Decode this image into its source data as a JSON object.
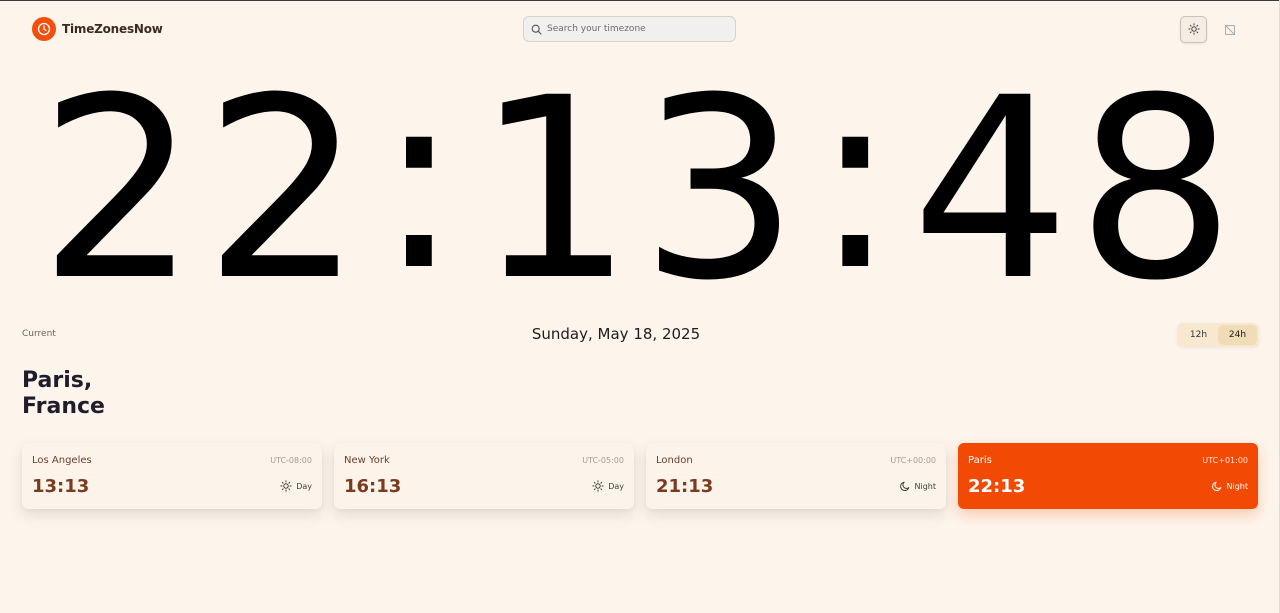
{
  "brand": {
    "name": "TimeZonesNow"
  },
  "search": {
    "placeholder": "Search your timezone"
  },
  "clock": {
    "hours": "22",
    "minutes": "13",
    "seconds": "48",
    "separator": ":"
  },
  "current_label": "Current",
  "date": "Sunday, May 18, 2025",
  "format": {
    "options": [
      "12h",
      "24h"
    ],
    "selected": "24h"
  },
  "location": {
    "city": "Paris,",
    "country": "France"
  },
  "cards": [
    {
      "city": "Los Angeles",
      "utc": "UTC-08:00",
      "time": "13:13",
      "period": "Day",
      "icon": "sun-icon"
    },
    {
      "city": "New York",
      "utc": "UTC-05:00",
      "time": "16:13",
      "period": "Day",
      "icon": "sun-icon"
    },
    {
      "city": "London",
      "utc": "UTC+00:00",
      "time": "21:13",
      "period": "Night",
      "icon": "moon-icon"
    },
    {
      "city": "Paris",
      "utc": "UTC+01:00",
      "time": "22:13",
      "period": "Night",
      "icon": "moon-icon",
      "active": true
    }
  ],
  "colors": {
    "accent": "#f24e0e",
    "background": "#fdf5ec",
    "card_time": "#7a3a1e"
  }
}
